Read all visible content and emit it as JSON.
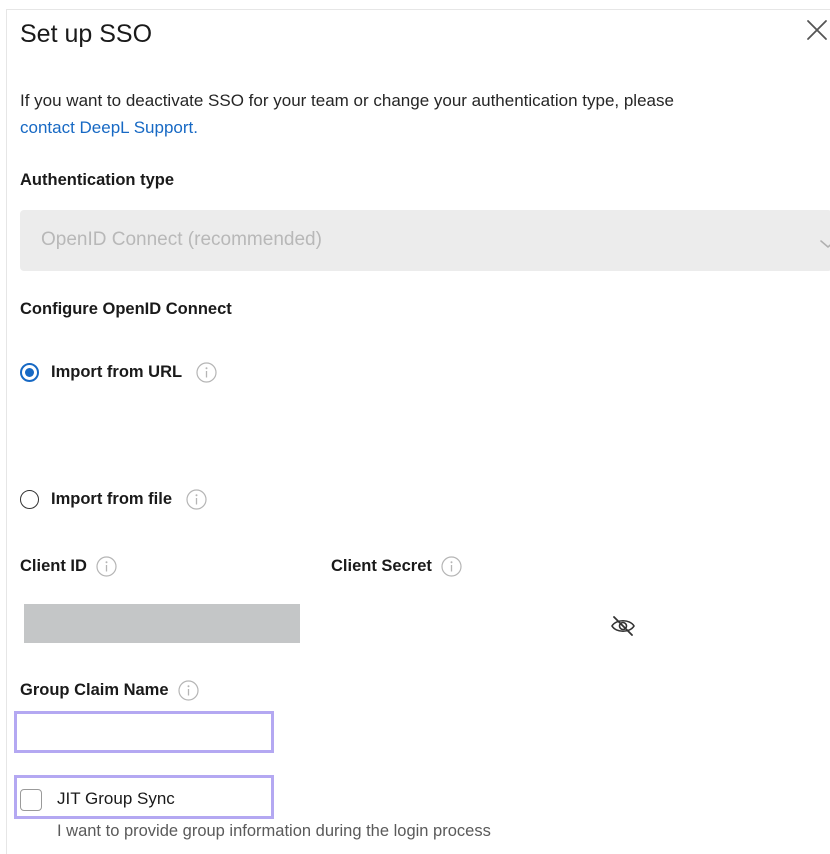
{
  "dialog": {
    "title": "Set up SSO",
    "description_prefix": "If you want to deactivate SSO for your team or change your authentication type, please",
    "description_link": "contact DeepL Support."
  },
  "auth_type": {
    "label": "Authentication type",
    "selected": "OpenID Connect (recommended)"
  },
  "config": {
    "heading": "Configure OpenID Connect",
    "options": [
      {
        "label": "Import from URL",
        "checked": true
      },
      {
        "label": "Import from file",
        "checked": false
      }
    ]
  },
  "fields": {
    "client_id_label": "Client ID",
    "client_secret_label": "Client Secret",
    "group_claim_label": "Group Claim Name",
    "group_claim_value": ""
  },
  "jit": {
    "label": "JIT Group Sync",
    "checked": false,
    "help": "I want to provide group information during the login process"
  },
  "colors": {
    "link": "#1769c4",
    "highlight_border": "#b4a8f2",
    "select_bg": "#ececec",
    "redacted": "#c4c6c7"
  },
  "icons": [
    "close-icon",
    "chevron-down-icon",
    "info-icon",
    "eye-off-icon"
  ]
}
